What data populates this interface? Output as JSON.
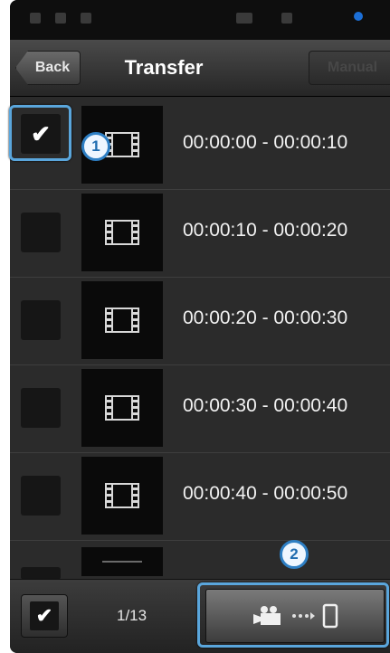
{
  "header": {
    "back_label": "Back",
    "title": "Transfer",
    "manual_label": "Manual"
  },
  "list": {
    "items": [
      {
        "range": "00:00:00 - 00:00:10",
        "checked": true
      },
      {
        "range": "00:00:10 - 00:00:20",
        "checked": false
      },
      {
        "range": "00:00:20 - 00:00:30",
        "checked": false
      },
      {
        "range": "00:00:30 - 00:00:40",
        "checked": false
      },
      {
        "range": "00:00:40 - 00:00:50",
        "checked": false
      }
    ]
  },
  "footer": {
    "counter": "1/13",
    "check_glyph": "✔"
  },
  "callouts": {
    "one": "1",
    "two": "2"
  },
  "colors": {
    "highlight": "#5aa6dc",
    "badge_border": "#2e7fc4"
  },
  "icons": [
    "film-icon",
    "check-icon",
    "camera-icon",
    "arrow-dots-icon",
    "phone-icon"
  ]
}
